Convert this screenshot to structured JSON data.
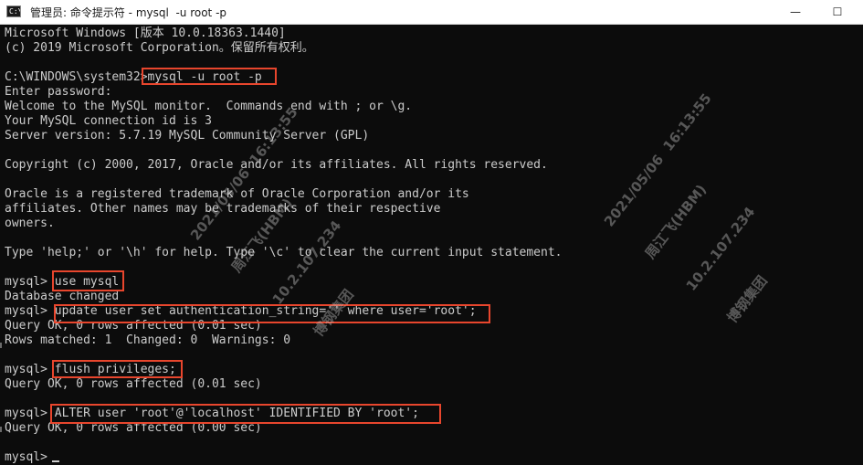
{
  "window": {
    "title": "管理员: 命令提示符 - mysql  -u root -p",
    "icon": "cmd-icon",
    "minimize_glyph": "—",
    "maximize_glyph": "☐",
    "minimize_icon": "minimize-icon",
    "maximize_icon": "maximize-icon"
  },
  "terminal": {
    "lines": [
      "Microsoft Windows [版本 10.0.18363.1440]",
      "(c) 2019 Microsoft Corporation。保留所有权利。",
      "",
      "C:\\WINDOWS\\system32>mysql -u root -p",
      "Enter password:",
      "Welcome to the MySQL monitor.  Commands end with ; or \\g.",
      "Your MySQL connection id is 3",
      "Server version: 5.7.19 MySQL Community Server (GPL)",
      "",
      "Copyright (c) 2000, 2017, Oracle and/or its affiliates. All rights reserved.",
      "",
      "Oracle is a registered trademark of Oracle Corporation and/or its",
      "affiliates. Other names may be trademarks of their respective",
      "owners.",
      "",
      "Type 'help;' or '\\h' for help. Type '\\c' to clear the current input statement.",
      "",
      "mysql> use mysql",
      "Database changed",
      "mysql> update user set authentication_string='' where user='root';",
      "Query OK, 0 rows affected (0.01 sec)",
      "Rows matched: 1  Changed: 0  Warnings: 0",
      "",
      "mysql> flush privileges;",
      "Query OK, 0 rows affected (0.01 sec)",
      "",
      "mysql> ALTER user 'root'@'localhost' IDENTIFIED BY 'root';",
      "Query OK, 0 rows affected (0.00 sec)",
      "",
      "mysql>"
    ]
  },
  "watermarks": [
    {
      "lines": [
        "2021/05/06  16:13:55",
        "周江飞(HBM)",
        "10.2.107.234",
        "博钢集团"
      ]
    },
    {
      "lines": [
        "2021/05/06  16:13:55",
        "周江飞(HBM)",
        "10.2.107.234",
        "博钢集团"
      ]
    }
  ],
  "colors": {
    "terminal_bg": "#0c0c0c",
    "terminal_text": "#cccccc",
    "highlight": "#e8462d",
    "titlebar_bg": "#ffffff"
  }
}
